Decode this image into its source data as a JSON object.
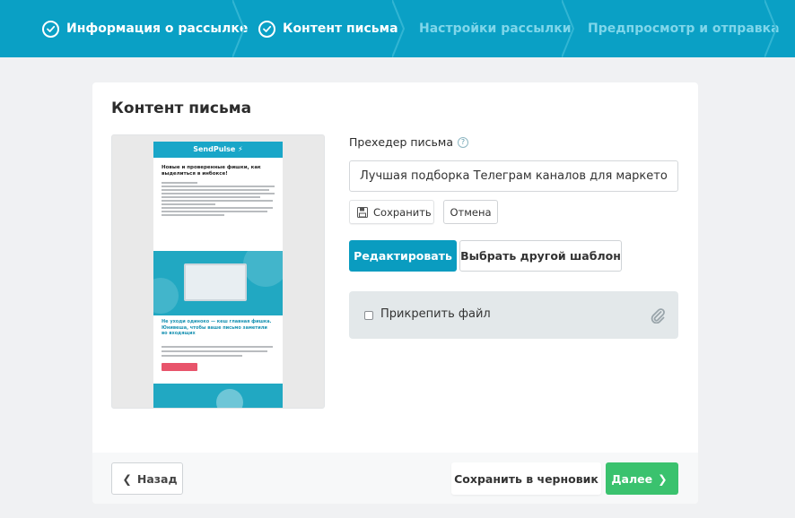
{
  "stepper": {
    "steps": [
      {
        "label": "Информация о рассылке",
        "state": "done"
      },
      {
        "label": "Контент письма",
        "state": "done"
      },
      {
        "label": "Настройки рассылки",
        "state": "todo"
      },
      {
        "label": "Предпросмотр и отправка",
        "state": "todo"
      }
    ]
  },
  "content": {
    "title": "Контент письма",
    "preview": {
      "brand": "SendPulse",
      "headline": "Новые и проверенные фишки, как выделиться в инбоксе!",
      "subhead": "Не уходи одиноко — кеш главная фишка. Юнивеша, чтобы ваше письмо заметили во входящих"
    },
    "preheader": {
      "label": "Прехедер письма",
      "help_icon": "question-circle-icon",
      "value": "Лучшая подборка Телеграм каналов для маркетолога",
      "save_label": "Сохранить",
      "cancel_label": "Отмена"
    },
    "actions": {
      "edit_label": "Редактировать",
      "template_label": "Выбрать другой шаблон"
    },
    "attachment": {
      "label": "Прикрепить файл",
      "checked": false
    }
  },
  "footer": {
    "back_label": "Назад",
    "draft_label": "Сохранить в черновик",
    "next_label": "Далее"
  },
  "colors": {
    "header": "#0aa0c5",
    "primary": "#0a9cc0",
    "success": "#3ac26e",
    "background": "#f0f1f3"
  }
}
